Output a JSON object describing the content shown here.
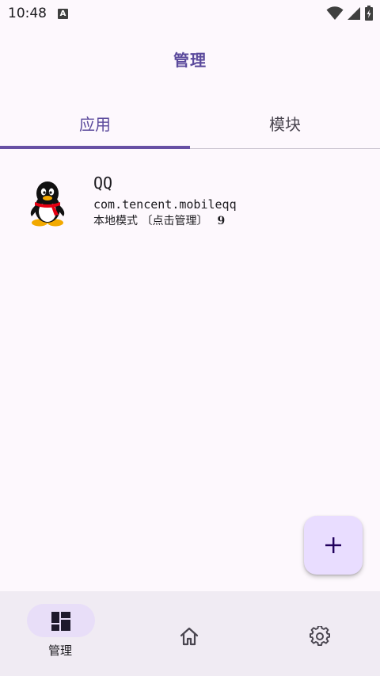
{
  "status_bar": {
    "time": "10:48",
    "notification_glyph": "A",
    "icons": [
      "wifi-icon",
      "signal-icon",
      "battery-icon"
    ]
  },
  "top_bar": {
    "title": "管理"
  },
  "tabs": [
    {
      "label": "应用",
      "selected": true
    },
    {
      "label": "模块",
      "selected": false
    }
  ],
  "apps": [
    {
      "name": "QQ",
      "package": "com.tencent.mobileqq",
      "mode": "本地模式 〔点击管理〕",
      "count": "9",
      "icon": "qq-penguin-icon"
    }
  ],
  "fab": {
    "icon": "plus-icon"
  },
  "bottom_nav": [
    {
      "label": "管理",
      "icon": "dashboard-icon",
      "selected": true
    },
    {
      "label": "",
      "icon": "home-icon",
      "selected": false
    },
    {
      "label": "",
      "icon": "settings-icon",
      "selected": false
    }
  ],
  "colors": {
    "accent": "#6750a4",
    "title": "#5b4a9c",
    "background": "#fdf8fd",
    "fab_bg": "#e9ddff",
    "nav_bg": "#f0ebf3",
    "nav_pill": "#e8def8"
  }
}
